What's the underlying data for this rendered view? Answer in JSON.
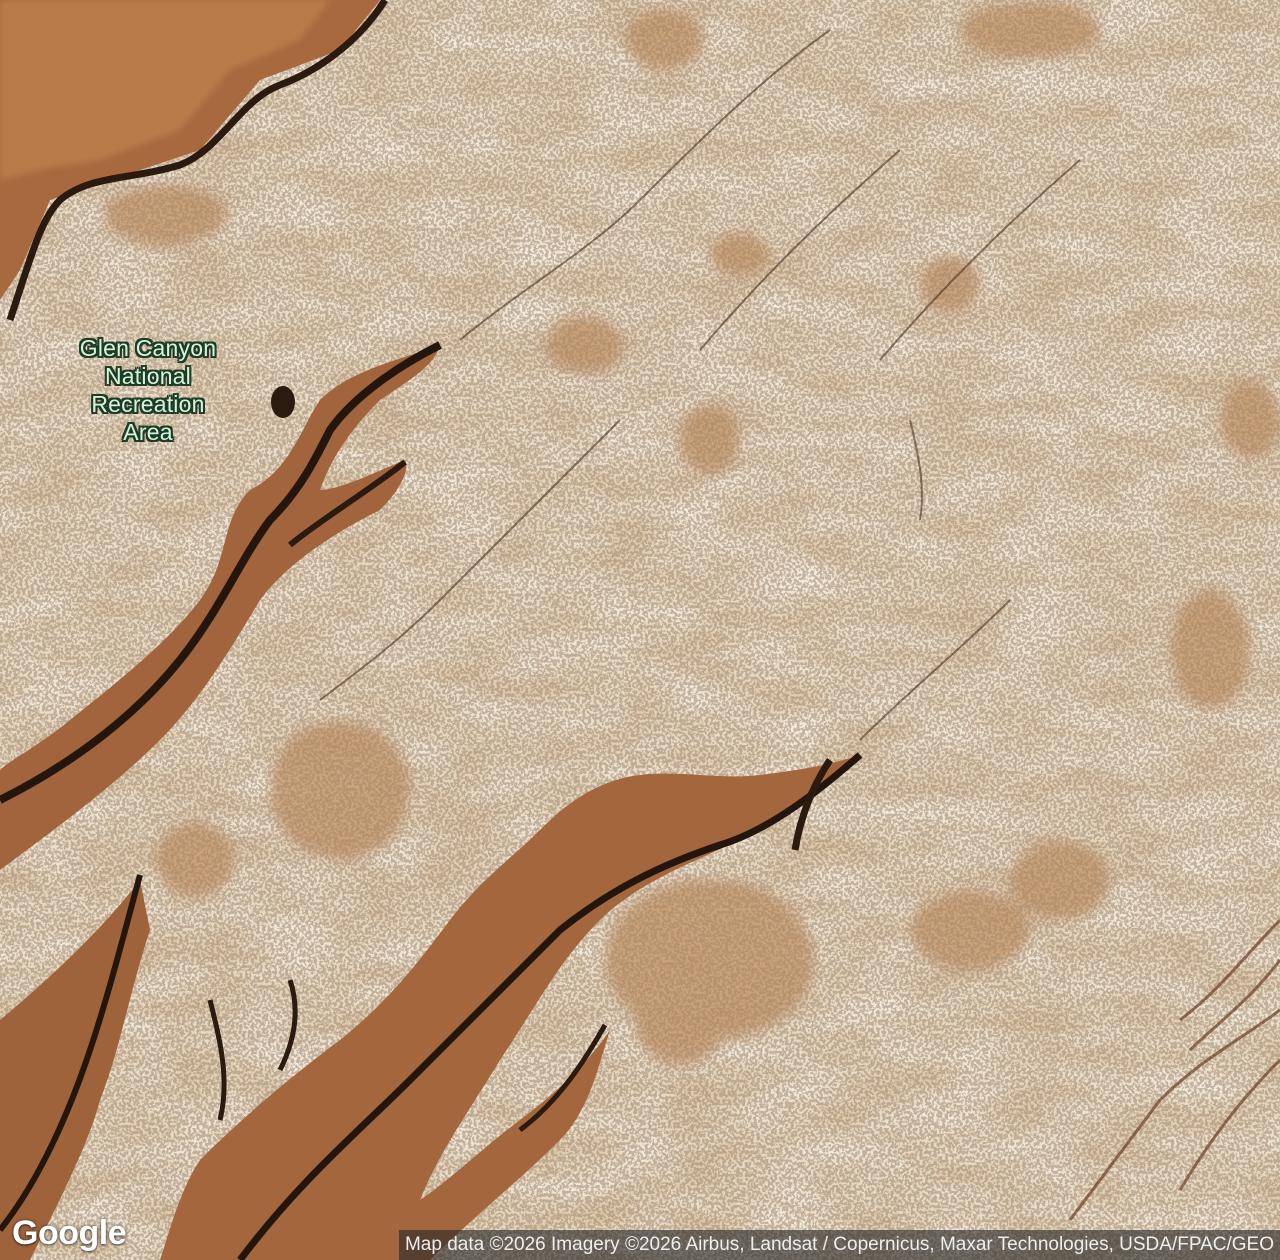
{
  "map": {
    "view": "satellite",
    "place_label": {
      "lines": [
        "Glen Canyon",
        "National",
        "Recreation",
        "Area"
      ],
      "color": "#d2f5dc",
      "halo_color": "#1f3b26"
    },
    "logo": {
      "text": "Google"
    },
    "attribution": {
      "text": "Map data ©2026 Imagery ©2026 Airbus, Landsat / Copernicus, Maxar Technologies, USDA/FPAC/GEO"
    },
    "palette": {
      "slickrock": "#e6d6bd",
      "sand": "#c89a68",
      "canyon_wall": "#a0643a",
      "canyon_shadow": "#2a1a10"
    }
  }
}
